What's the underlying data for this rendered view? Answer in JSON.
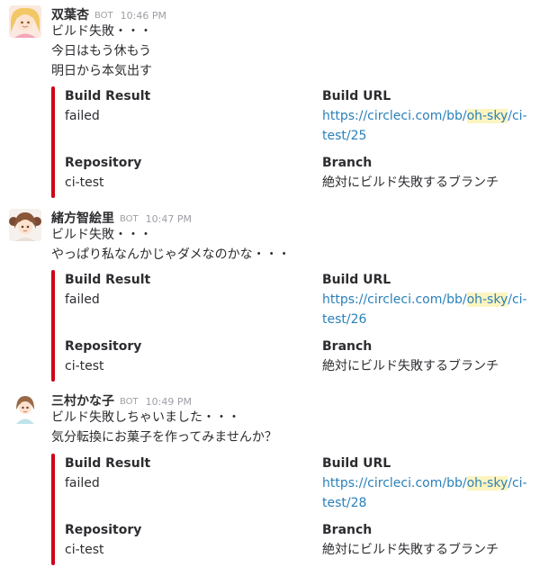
{
  "bot_badge": "BOT",
  "messages": [
    {
      "sender": "双葉杏",
      "time": "10:46 PM",
      "lines": [
        "ビルド失敗・・・",
        "今日はもう休もう",
        "明日から本気出す"
      ],
      "attachment": {
        "color": "#d0021b",
        "build_result_title": "Build Result",
        "build_result_value": "failed",
        "build_url_title": "Build URL",
        "url_prefix": "https://circleci.com/bb/",
        "url_highlight": "oh-sky",
        "url_suffix": "/ci-test/25",
        "repository_title": "Repository",
        "repository_value": "ci-test",
        "branch_title": "Branch",
        "branch_value": "絶対にビルド失敗するブランチ"
      }
    },
    {
      "sender": "緒方智絵里",
      "time": "10:47 PM",
      "lines": [
        "ビルド失敗・・・",
        "やっぱり私なんかじゃダメなのかな・・・"
      ],
      "attachment": {
        "color": "#d0021b",
        "build_result_title": "Build Result",
        "build_result_value": "failed",
        "build_url_title": "Build URL",
        "url_prefix": "https://circleci.com/bb/",
        "url_highlight": "oh-sky",
        "url_suffix": "/ci-test/26",
        "repository_title": "Repository",
        "repository_value": "ci-test",
        "branch_title": "Branch",
        "branch_value": "絶対にビルド失敗するブランチ"
      }
    },
    {
      "sender": "三村かな子",
      "time": "10:49 PM",
      "lines": [
        "ビルド失敗しちゃいました・・・",
        "気分転換にお菓子を作ってみませんか？"
      ],
      "attachment": {
        "color": "#d0021b",
        "build_result_title": "Build Result",
        "build_result_value": "failed",
        "build_url_title": "Build URL",
        "url_prefix": "https://circleci.com/bb/",
        "url_highlight": "oh-sky",
        "url_suffix": "/ci-test/28",
        "repository_title": "Repository",
        "repository_value": "ci-test",
        "branch_title": "Branch",
        "branch_value": "絶対にビルド失敗するブランチ"
      }
    }
  ]
}
